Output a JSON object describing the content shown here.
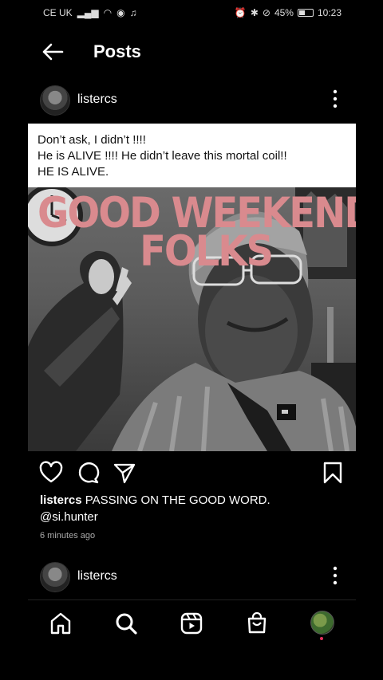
{
  "status_bar": {
    "carrier": "CE UK",
    "battery": "45%",
    "time": "10:23",
    "battery_level": 0.45
  },
  "header": {
    "title": "Posts"
  },
  "post": {
    "username": "listercs",
    "caption_box_lines": [
      "Don’t ask, I didn’t !!!!",
      "He is ALIVE !!!! He didn’t leave this mortal coil!!",
      "HE IS ALIVE."
    ],
    "overlay_text": "GOOD WEEKEND\nFOLKS",
    "caption_username": "listercs",
    "caption_text": "PASSING ON THE GOOD WORD.",
    "mention": "@si.hunter",
    "time_ago": "6 minutes ago"
  },
  "next_post": {
    "username": "listercs"
  },
  "icons": {
    "back": "arrow-left-icon",
    "more": "more-vertical-icon",
    "like": "heart-icon",
    "comment": "comment-icon",
    "share": "send-icon",
    "save": "bookmark-icon",
    "home": "home-icon",
    "search": "search-icon",
    "reels": "reels-icon",
    "shop": "shop-icon"
  },
  "colors": {
    "background": "#000000",
    "overlay_text": "#d98a8e",
    "notification_dot": "#e0305a"
  }
}
